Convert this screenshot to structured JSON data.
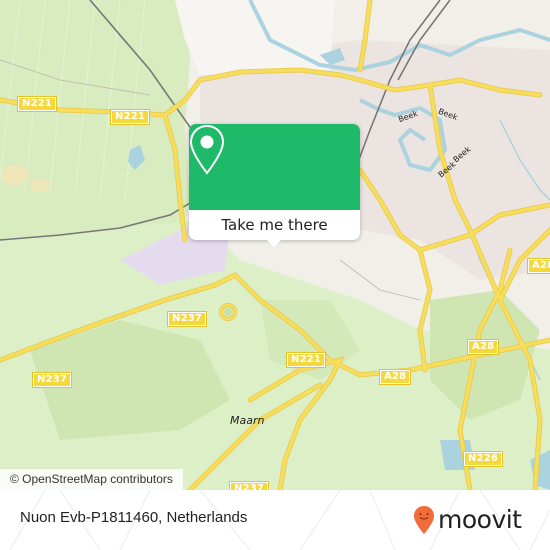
{
  "map": {
    "road_labels": [
      {
        "id": "n221-west",
        "text": "N221"
      },
      {
        "id": "n221-mid",
        "text": "N221"
      },
      {
        "id": "n237-east",
        "text": "N237"
      },
      {
        "id": "n237-west",
        "text": "N237"
      },
      {
        "id": "n221-south",
        "text": "N221"
      },
      {
        "id": "a28-mid",
        "text": "A28"
      },
      {
        "id": "a28-east",
        "text": "A28"
      },
      {
        "id": "n226",
        "text": "N226"
      },
      {
        "id": "n237-bottom",
        "text": "N237"
      }
    ],
    "place_labels": [
      {
        "id": "maarn",
        "text": "Maarn"
      }
    ],
    "water_labels": [
      {
        "id": "beek-1",
        "text": "Beek"
      },
      {
        "id": "beek-2",
        "text": "Beek"
      },
      {
        "id": "beek-3",
        "text": "Beek"
      },
      {
        "id": "beek-4",
        "text": "Beek"
      }
    ],
    "attribution": "© OpenStreetMap contributors",
    "colors": {
      "background": "#f2efe9",
      "green": "#d8ecc0",
      "road": "#f7dd5c",
      "water": "#aad3df",
      "railway": "#777777",
      "urban": "#e8e0dc"
    }
  },
  "popup": {
    "icon": "location-pin-icon",
    "button_label": "Take me there",
    "accent_color": "#1fb96a"
  },
  "footer": {
    "title": "Nuon Evb-P1811460, Netherlands",
    "brand": {
      "icon": "moovit-pin-icon",
      "name": "moovit",
      "color": "#f26b3a"
    }
  }
}
